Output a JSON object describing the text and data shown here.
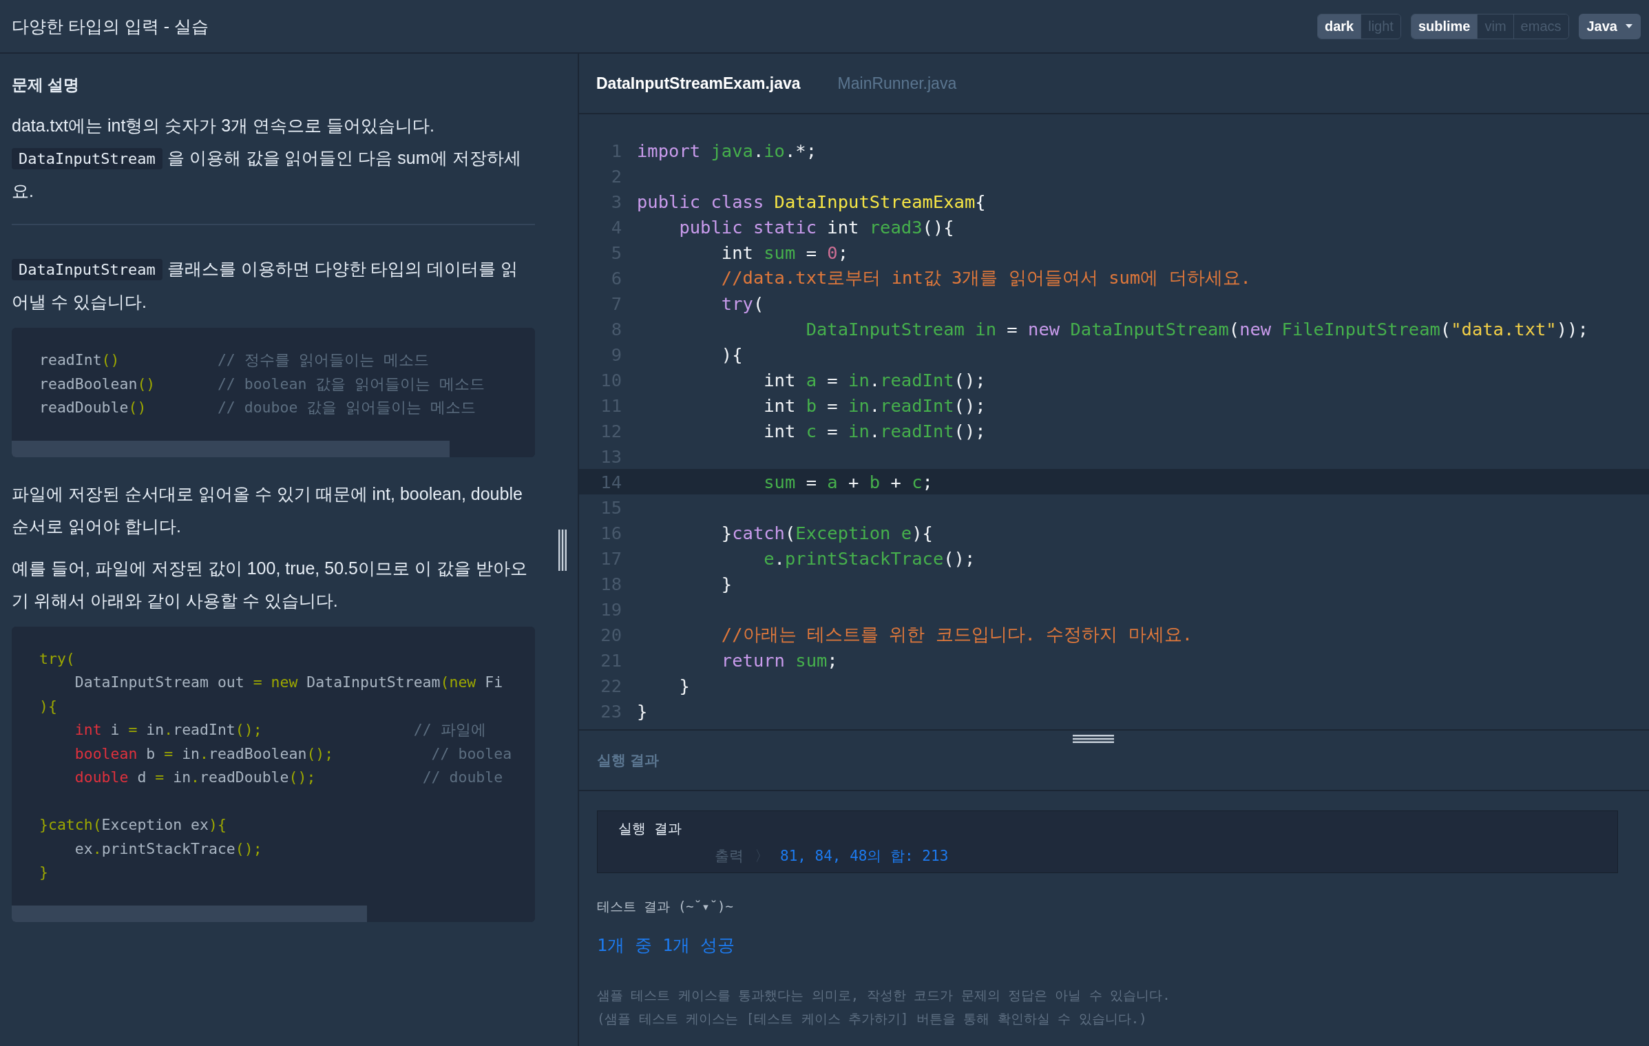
{
  "header": {
    "title": "다양한 타입의 입력 - 실습",
    "theme_toggle": [
      {
        "label": "dark",
        "selected": true
      },
      {
        "label": "light",
        "selected": false
      }
    ],
    "keymap_toggle": [
      {
        "label": "sublime",
        "selected": true
      },
      {
        "label": "vim",
        "selected": false
      },
      {
        "label": "emacs",
        "selected": false
      }
    ],
    "language": "Java"
  },
  "problem": {
    "heading": "문제 설명",
    "blocks": [
      {
        "kind": "para",
        "lines": [
          [
            {
              "kind": "text",
              "t": "data.txt에는 int형의 숫자가 3개 연속으로 들어있습니다."
            }
          ],
          [
            {
              "kind": "code",
              "t": "DataInputStream"
            },
            {
              "kind": "text",
              "t": " 을 이용해 값을 읽어들인 다음 sum에 저장하세요."
            }
          ]
        ]
      },
      {
        "kind": "rule"
      },
      {
        "kind": "para",
        "lines": [
          [
            {
              "kind": "code",
              "t": "DataInputStream"
            },
            {
              "kind": "text",
              "t": " 클래스를 이용하면 다양한 타입의 데이터를 읽어낼 수 있습니다."
            }
          ]
        ]
      },
      {
        "kind": "code",
        "lines": [
          {
            "kind": "code",
            "tokens": [
              {
                "kind": "p",
                "t": "readInt"
              },
              {
                "kind": "y",
                "t": "()"
              },
              {
                "kind": "c",
                "t": "           // 정수를 읽어들이는 메소드"
              }
            ]
          },
          {
            "kind": "code",
            "tokens": [
              {
                "kind": "p",
                "t": "readBoolean"
              },
              {
                "kind": "y",
                "t": "()"
              },
              {
                "kind": "c",
                "t": "       // boolean 값을 읽어들이는 메소드"
              }
            ]
          },
          {
            "kind": "code",
            "tokens": [
              {
                "kind": "p",
                "t": "readDouble"
              },
              {
                "kind": "y",
                "t": "()"
              },
              {
                "kind": "c",
                "t": "        // douboe 값을 읽어들이는 메소드"
              }
            ]
          }
        ]
      },
      {
        "kind": "para",
        "lines": [
          [
            {
              "kind": "text",
              "t": "파일에 저장된 순서대로 읽어올 수 있기 때문에 int, boolean, double 순서로 읽어야 합니다."
            }
          ]
        ]
      },
      {
        "kind": "para",
        "lines": [
          [
            {
              "kind": "text",
              "t": "예를 들어, 파일에 저장된 값이 100, true, 50.5이므로 이 값을 받아오기 위해서 아래와 같이 사용할 수 있습니다."
            }
          ]
        ]
      },
      {
        "kind": "code",
        "lines": [
          {
            "kind": "code",
            "tokens": [
              {
                "kind": "y",
                "t": "try("
              }
            ]
          },
          {
            "kind": "code",
            "tokens": [
              {
                "kind": "p",
                "t": "    DataInputStream out "
              },
              {
                "kind": "y",
                "t": "= new "
              },
              {
                "kind": "p",
                "t": "DataInputStream"
              },
              {
                "kind": "y",
                "t": "(new "
              },
              {
                "kind": "p",
                "t": "Fi"
              }
            ]
          },
          {
            "kind": "code",
            "tokens": [
              {
                "kind": "y",
                "t": "){"
              }
            ]
          },
          {
            "kind": "code",
            "tokens": [
              {
                "kind": "r",
                "t": "    int"
              },
              {
                "kind": "p",
                "t": " i "
              },
              {
                "kind": "y",
                "t": "="
              },
              {
                "kind": "p",
                "t": " in"
              },
              {
                "kind": "y",
                "t": "."
              },
              {
                "kind": "p",
                "t": "readInt"
              },
              {
                "kind": "y",
                "t": "();"
              },
              {
                "kind": "c",
                "t": "                 // 파일에"
              }
            ]
          },
          {
            "kind": "code",
            "tokens": [
              {
                "kind": "r",
                "t": "    boolean"
              },
              {
                "kind": "p",
                "t": " b "
              },
              {
                "kind": "y",
                "t": "="
              },
              {
                "kind": "p",
                "t": " in"
              },
              {
                "kind": "y",
                "t": "."
              },
              {
                "kind": "p",
                "t": "readBoolean"
              },
              {
                "kind": "y",
                "t": "();"
              },
              {
                "kind": "c",
                "t": "           // boolea"
              }
            ]
          },
          {
            "kind": "code",
            "tokens": [
              {
                "kind": "r",
                "t": "    double"
              },
              {
                "kind": "p",
                "t": " d "
              },
              {
                "kind": "y",
                "t": "="
              },
              {
                "kind": "p",
                "t": " in"
              },
              {
                "kind": "y",
                "t": "."
              },
              {
                "kind": "p",
                "t": "readDouble"
              },
              {
                "kind": "y",
                "t": "();"
              },
              {
                "kind": "c",
                "t": "            // double"
              }
            ]
          },
          {
            "kind": "blank"
          },
          {
            "kind": "code",
            "tokens": [
              {
                "kind": "y",
                "t": "}catch("
              },
              {
                "kind": "p",
                "t": "Exception ex"
              },
              {
                "kind": "y",
                "t": "){"
              }
            ]
          },
          {
            "kind": "code",
            "tokens": [
              {
                "kind": "p",
                "t": "    ex"
              },
              {
                "kind": "y",
                "t": "."
              },
              {
                "kind": "p",
                "t": "printStackTrace"
              },
              {
                "kind": "y",
                "t": "();"
              }
            ]
          },
          {
            "kind": "code",
            "tokens": [
              {
                "kind": "y",
                "t": "}"
              }
            ]
          }
        ]
      }
    ]
  },
  "editor": {
    "tabs": [
      {
        "label": "DataInputStreamExam.java",
        "selected": true
      },
      {
        "label": "MainRunner.java",
        "selected": false
      }
    ],
    "lines": [
      {
        "n": "1",
        "current": false,
        "tokens": [
          {
            "kind": "kw",
            "t": "import "
          },
          {
            "kind": "fn",
            "t": "java"
          },
          {
            "kind": "p",
            "t": "."
          },
          {
            "kind": "fn",
            "t": "io"
          },
          {
            "kind": "p",
            "t": ".*;"
          }
        ]
      },
      {
        "n": "2",
        "current": false
      },
      {
        "n": "3",
        "current": false,
        "tokens": [
          {
            "kind": "kw",
            "t": "public class "
          },
          {
            "kind": "cls",
            "t": "DataInputStreamExam"
          },
          {
            "kind": "p",
            "t": "{"
          }
        ]
      },
      {
        "n": "4",
        "current": false,
        "tokens": [
          {
            "kind": "kw",
            "t": "    public static "
          },
          {
            "kind": "p",
            "t": "int "
          },
          {
            "kind": "fn",
            "t": "read3"
          },
          {
            "kind": "p",
            "t": "(){"
          }
        ]
      },
      {
        "n": "5",
        "current": false,
        "tokens": [
          {
            "kind": "p",
            "t": "        int "
          },
          {
            "kind": "fn",
            "t": "sum"
          },
          {
            "kind": "p",
            "t": " = "
          },
          {
            "kind": "num",
            "t": "0"
          },
          {
            "kind": "p",
            "t": ";"
          }
        ]
      },
      {
        "n": "6",
        "current": false,
        "tokens": [
          {
            "kind": "cm",
            "t": "        //data.txt로부터 int값 3개를 읽어들여서 sum에 더하세요."
          }
        ]
      },
      {
        "n": "7",
        "current": false,
        "tokens": [
          {
            "kind": "kw",
            "t": "        try"
          },
          {
            "kind": "p",
            "t": "("
          }
        ]
      },
      {
        "n": "8",
        "current": false,
        "tokens": [
          {
            "kind": "fn",
            "t": "                DataInputStream in"
          },
          {
            "kind": "p",
            "t": " = "
          },
          {
            "kind": "kw",
            "t": "new "
          },
          {
            "kind": "fn",
            "t": "DataInputStream"
          },
          {
            "kind": "p",
            "t": "("
          },
          {
            "kind": "kw",
            "t": "new "
          },
          {
            "kind": "fn",
            "t": "FileInputStream"
          },
          {
            "kind": "p",
            "t": "("
          },
          {
            "kind": "str",
            "t": "\"data.txt\""
          },
          {
            "kind": "p",
            "t": "));"
          }
        ]
      },
      {
        "n": "9",
        "current": false,
        "tokens": [
          {
            "kind": "p",
            "t": "        ){"
          }
        ]
      },
      {
        "n": "10",
        "current": false,
        "tokens": [
          {
            "kind": "p",
            "t": "            int "
          },
          {
            "kind": "fn",
            "t": "a"
          },
          {
            "kind": "p",
            "t": " = "
          },
          {
            "kind": "fn",
            "t": "in"
          },
          {
            "kind": "p",
            "t": "."
          },
          {
            "kind": "fn",
            "t": "readInt"
          },
          {
            "kind": "p",
            "t": "();"
          }
        ]
      },
      {
        "n": "11",
        "current": false,
        "tokens": [
          {
            "kind": "p",
            "t": "            int "
          },
          {
            "kind": "fn",
            "t": "b"
          },
          {
            "kind": "p",
            "t": " = "
          },
          {
            "kind": "fn",
            "t": "in"
          },
          {
            "kind": "p",
            "t": "."
          },
          {
            "kind": "fn",
            "t": "readInt"
          },
          {
            "kind": "p",
            "t": "();"
          }
        ]
      },
      {
        "n": "12",
        "current": false,
        "tokens": [
          {
            "kind": "p",
            "t": "            int "
          },
          {
            "kind": "fn",
            "t": "c"
          },
          {
            "kind": "p",
            "t": " = "
          },
          {
            "kind": "fn",
            "t": "in"
          },
          {
            "kind": "p",
            "t": "."
          },
          {
            "kind": "fn",
            "t": "readInt"
          },
          {
            "kind": "p",
            "t": "();"
          }
        ]
      },
      {
        "n": "13",
        "current": false
      },
      {
        "n": "14",
        "current": true,
        "tokens": [
          {
            "kind": "fn",
            "t": "            sum"
          },
          {
            "kind": "p",
            "t": " = "
          },
          {
            "kind": "fn",
            "t": "a"
          },
          {
            "kind": "p",
            "t": " + "
          },
          {
            "kind": "fn",
            "t": "b"
          },
          {
            "kind": "p",
            "t": " + "
          },
          {
            "kind": "fn",
            "t": "c"
          },
          {
            "kind": "p",
            "t": ";"
          }
        ]
      },
      {
        "n": "15",
        "current": false
      },
      {
        "n": "16",
        "current": false,
        "tokens": [
          {
            "kind": "p",
            "t": "        }"
          },
          {
            "kind": "kw",
            "t": "catch"
          },
          {
            "kind": "p",
            "t": "("
          },
          {
            "kind": "fn",
            "t": "Exception e"
          },
          {
            "kind": "p",
            "t": "){"
          }
        ]
      },
      {
        "n": "17",
        "current": false,
        "tokens": [
          {
            "kind": "fn",
            "t": "            e"
          },
          {
            "kind": "p",
            "t": "."
          },
          {
            "kind": "fn",
            "t": "printStackTrace"
          },
          {
            "kind": "p",
            "t": "();"
          }
        ]
      },
      {
        "n": "18",
        "current": false,
        "tokens": [
          {
            "kind": "p",
            "t": "        }"
          }
        ]
      },
      {
        "n": "19",
        "current": false
      },
      {
        "n": "20",
        "current": false,
        "tokens": [
          {
            "kind": "cm",
            "t": "        //아래는 테스트를 위한 코드입니다. 수정하지 마세요."
          }
        ]
      },
      {
        "n": "21",
        "current": false,
        "tokens": [
          {
            "kind": "kw",
            "t": "        return "
          },
          {
            "kind": "fn",
            "t": "sum"
          },
          {
            "kind": "p",
            "t": ";"
          }
        ]
      },
      {
        "n": "22",
        "current": false,
        "tokens": [
          {
            "kind": "p",
            "t": "    }"
          }
        ]
      },
      {
        "n": "23",
        "current": false,
        "tokens": [
          {
            "kind": "p",
            "t": "}"
          }
        ]
      }
    ]
  },
  "results": {
    "heading": "실행 결과",
    "console": {
      "title": "실행 결과",
      "output_label": "출력",
      "output_arrow": "〉",
      "output_value": "81, 84, 48의 합: 213"
    },
    "test_title": "테스트 결과 (~˘▾˘)~",
    "test_summary": "1개 중 1개 성공",
    "notes": [
      "샘플 테스트 케이스를 통과했다는 의미로, 작성한 코드가 문제의 정답은 아닐 수 있습니다.",
      "(샘플 테스트 케이스는 [테스트 케이스 추가하기] 버튼을 통해 확인하실 수 있습니다.)"
    ]
  }
}
